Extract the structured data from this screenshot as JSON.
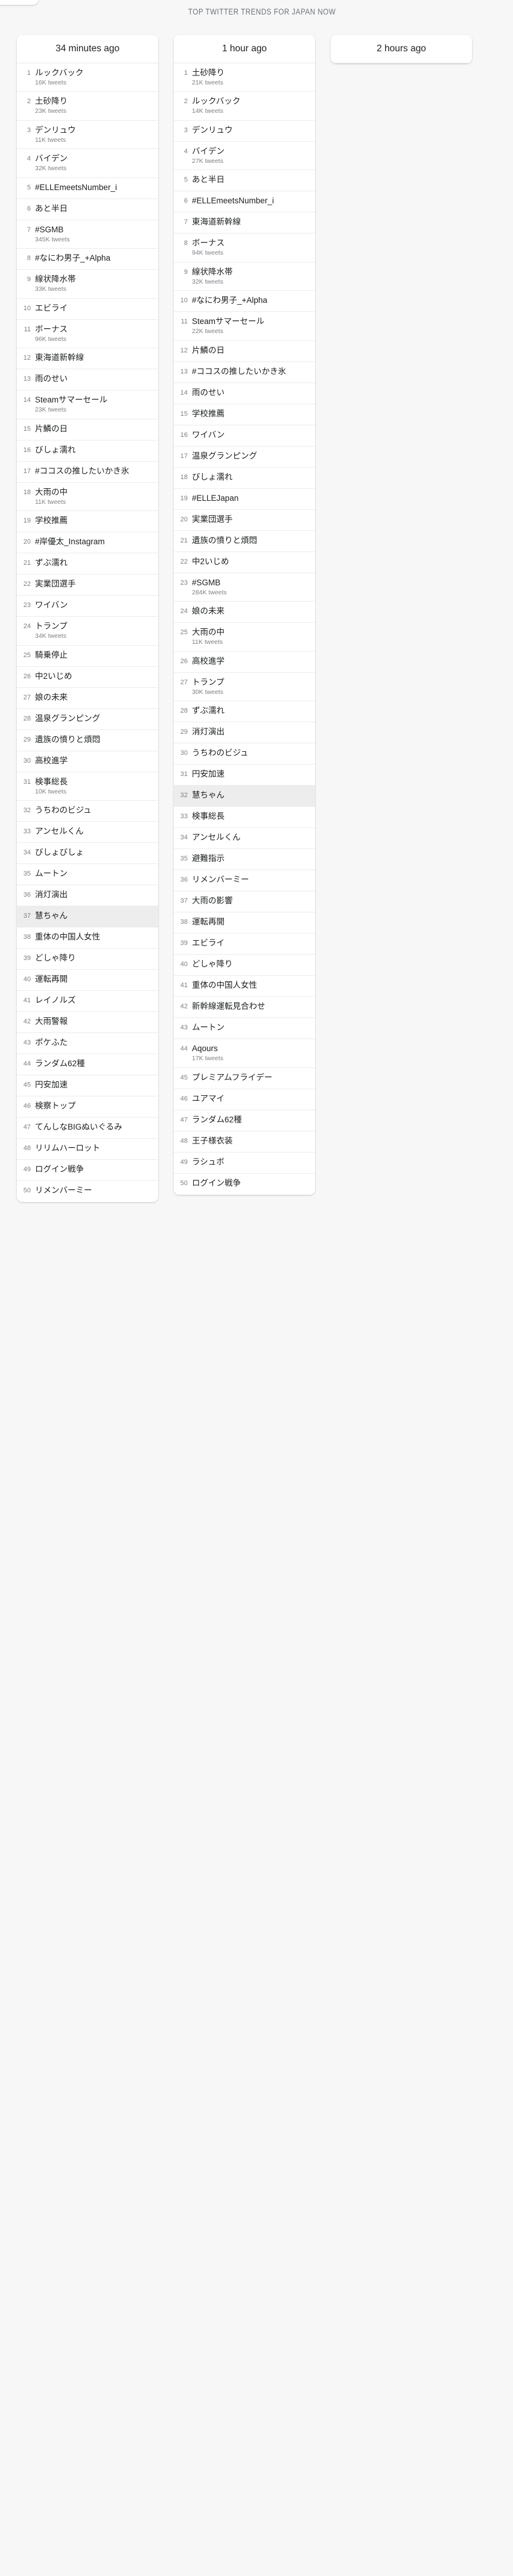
{
  "page": {
    "header_title": "TOP TWITTER TRENDS FOR JAPAN NOW",
    "background_color": "#f7f7f8",
    "card_color": "#ffffff",
    "highlight_color": "#ededed",
    "text_color": "#1b1d1f",
    "muted_color": "#7d8085"
  },
  "columns": [
    {
      "timestamp_label": "34 minutes ago",
      "items": [
        {
          "rank": "1",
          "name": "ルックバック",
          "count": "16K tweets",
          "highlight": false
        },
        {
          "rank": "2",
          "name": "土砂降り",
          "count": "23K tweets",
          "highlight": false
        },
        {
          "rank": "3",
          "name": "デンリュウ",
          "count": "11K tweets",
          "highlight": false
        },
        {
          "rank": "4",
          "name": "バイデン",
          "count": "32K tweets",
          "highlight": false
        },
        {
          "rank": "5",
          "name": "#ELLEmeetsNumber_i",
          "count": "",
          "highlight": false
        },
        {
          "rank": "6",
          "name": "あと半日",
          "count": "",
          "highlight": false
        },
        {
          "rank": "7",
          "name": "#SGMB",
          "count": "345K tweets",
          "highlight": false
        },
        {
          "rank": "8",
          "name": "#なにわ男子_+Alpha",
          "count": "",
          "highlight": false
        },
        {
          "rank": "9",
          "name": "線状降水帯",
          "count": "33K tweets",
          "highlight": false
        },
        {
          "rank": "10",
          "name": "エビライ",
          "count": "",
          "highlight": false
        },
        {
          "rank": "11",
          "name": "ボーナス",
          "count": "96K tweets",
          "highlight": false
        },
        {
          "rank": "12",
          "name": "東海道新幹線",
          "count": "",
          "highlight": false
        },
        {
          "rank": "13",
          "name": "雨のせい",
          "count": "",
          "highlight": false
        },
        {
          "rank": "14",
          "name": "Steamサマーセール",
          "count": "23K tweets",
          "highlight": false
        },
        {
          "rank": "15",
          "name": "片鱗の日",
          "count": "",
          "highlight": false
        },
        {
          "rank": "16",
          "name": "びしょ濡れ",
          "count": "",
          "highlight": false
        },
        {
          "rank": "17",
          "name": "#ココスの推したいかき氷",
          "count": "",
          "highlight": false
        },
        {
          "rank": "18",
          "name": "大雨の中",
          "count": "11K tweets",
          "highlight": false
        },
        {
          "rank": "19",
          "name": "学校推薦",
          "count": "",
          "highlight": false
        },
        {
          "rank": "20",
          "name": "#岸優太_Instagram",
          "count": "",
          "highlight": false
        },
        {
          "rank": "21",
          "name": "ずぶ濡れ",
          "count": "",
          "highlight": false
        },
        {
          "rank": "22",
          "name": "実業団選手",
          "count": "",
          "highlight": false
        },
        {
          "rank": "23",
          "name": "ワイバン",
          "count": "",
          "highlight": false
        },
        {
          "rank": "24",
          "name": "トランプ",
          "count": "34K tweets",
          "highlight": false
        },
        {
          "rank": "25",
          "name": "騎乗停止",
          "count": "",
          "highlight": false
        },
        {
          "rank": "26",
          "name": "中2いじめ",
          "count": "",
          "highlight": false
        },
        {
          "rank": "27",
          "name": "娘の未来",
          "count": "",
          "highlight": false
        },
        {
          "rank": "28",
          "name": "温泉グランピング",
          "count": "",
          "highlight": false
        },
        {
          "rank": "29",
          "name": "遺族の憤りと煩悶",
          "count": "",
          "highlight": false
        },
        {
          "rank": "30",
          "name": "高校進学",
          "count": "",
          "highlight": false
        },
        {
          "rank": "31",
          "name": "検事総長",
          "count": "10K tweets",
          "highlight": false
        },
        {
          "rank": "32",
          "name": "うちわのビジュ",
          "count": "",
          "highlight": false
        },
        {
          "rank": "33",
          "name": "アンセルくん",
          "count": "",
          "highlight": false
        },
        {
          "rank": "34",
          "name": "びしょびしょ",
          "count": "",
          "highlight": false
        },
        {
          "rank": "35",
          "name": "ムートン",
          "count": "",
          "highlight": false
        },
        {
          "rank": "36",
          "name": "消灯演出",
          "count": "",
          "highlight": false
        },
        {
          "rank": "37",
          "name": "慧ちゃん",
          "count": "",
          "highlight": true
        },
        {
          "rank": "38",
          "name": "重体の中国人女性",
          "count": "",
          "highlight": false
        },
        {
          "rank": "39",
          "name": "どしゃ降り",
          "count": "",
          "highlight": false
        },
        {
          "rank": "40",
          "name": "運転再開",
          "count": "",
          "highlight": false
        },
        {
          "rank": "41",
          "name": "レイノルズ",
          "count": "",
          "highlight": false
        },
        {
          "rank": "42",
          "name": "大雨警報",
          "count": "",
          "highlight": false
        },
        {
          "rank": "43",
          "name": "ポケふた",
          "count": "",
          "highlight": false
        },
        {
          "rank": "44",
          "name": "ランダム62種",
          "count": "",
          "highlight": false
        },
        {
          "rank": "45",
          "name": "円安加速",
          "count": "",
          "highlight": false
        },
        {
          "rank": "46",
          "name": "検察トップ",
          "count": "",
          "highlight": false
        },
        {
          "rank": "47",
          "name": "てんしなBIGぬいぐるみ",
          "count": "",
          "highlight": false
        },
        {
          "rank": "48",
          "name": "リリムハーロット",
          "count": "",
          "highlight": false
        },
        {
          "rank": "49",
          "name": "ログイン戦争",
          "count": "",
          "highlight": false
        },
        {
          "rank": "50",
          "name": "リメンバーミー",
          "count": "",
          "highlight": false
        }
      ]
    },
    {
      "timestamp_label": "1 hour ago",
      "items": [
        {
          "rank": "1",
          "name": "土砂降り",
          "count": "21K tweets",
          "highlight": false
        },
        {
          "rank": "2",
          "name": "ルックバック",
          "count": "14K tweets",
          "highlight": false
        },
        {
          "rank": "3",
          "name": "デンリュウ",
          "count": "",
          "highlight": false
        },
        {
          "rank": "4",
          "name": "バイデン",
          "count": "27K tweets",
          "highlight": false
        },
        {
          "rank": "5",
          "name": "あと半日",
          "count": "",
          "highlight": false
        },
        {
          "rank": "6",
          "name": "#ELLEmeetsNumber_i",
          "count": "",
          "highlight": false
        },
        {
          "rank": "7",
          "name": "東海道新幹線",
          "count": "",
          "highlight": false
        },
        {
          "rank": "8",
          "name": "ボーナス",
          "count": "94K tweets",
          "highlight": false
        },
        {
          "rank": "9",
          "name": "線状降水帯",
          "count": "32K tweets",
          "highlight": false
        },
        {
          "rank": "10",
          "name": "#なにわ男子_+Alpha",
          "count": "",
          "highlight": false
        },
        {
          "rank": "11",
          "name": "Steamサマーセール",
          "count": "22K tweets",
          "highlight": false
        },
        {
          "rank": "12",
          "name": "片鱗の日",
          "count": "",
          "highlight": false
        },
        {
          "rank": "13",
          "name": "#ココスの推したいかき氷",
          "count": "",
          "highlight": false
        },
        {
          "rank": "14",
          "name": "雨のせい",
          "count": "",
          "highlight": false
        },
        {
          "rank": "15",
          "name": "学校推薦",
          "count": "",
          "highlight": false
        },
        {
          "rank": "16",
          "name": "ワイバン",
          "count": "",
          "highlight": false
        },
        {
          "rank": "17",
          "name": "温泉グランピング",
          "count": "",
          "highlight": false
        },
        {
          "rank": "18",
          "name": "びしょ濡れ",
          "count": "",
          "highlight": false
        },
        {
          "rank": "19",
          "name": "#ELLEJapan",
          "count": "",
          "highlight": false
        },
        {
          "rank": "20",
          "name": "実業団選手",
          "count": "",
          "highlight": false
        },
        {
          "rank": "21",
          "name": "遺族の憤りと煩悶",
          "count": "",
          "highlight": false
        },
        {
          "rank": "22",
          "name": "中2いじめ",
          "count": "",
          "highlight": false
        },
        {
          "rank": "23",
          "name": "#SGMB",
          "count": "284K tweets",
          "highlight": false
        },
        {
          "rank": "24",
          "name": "娘の未来",
          "count": "",
          "highlight": false
        },
        {
          "rank": "25",
          "name": "大雨の中",
          "count": "11K tweets",
          "highlight": false
        },
        {
          "rank": "26",
          "name": "高校進学",
          "count": "",
          "highlight": false
        },
        {
          "rank": "27",
          "name": "トランプ",
          "count": "30K tweets",
          "highlight": false
        },
        {
          "rank": "28",
          "name": "ずぶ濡れ",
          "count": "",
          "highlight": false
        },
        {
          "rank": "29",
          "name": "消灯演出",
          "count": "",
          "highlight": false
        },
        {
          "rank": "30",
          "name": "うちわのビジュ",
          "count": "",
          "highlight": false
        },
        {
          "rank": "31",
          "name": "円安加速",
          "count": "",
          "highlight": false
        },
        {
          "rank": "32",
          "name": "慧ちゃん",
          "count": "",
          "highlight": true
        },
        {
          "rank": "33",
          "name": "検事総長",
          "count": "",
          "highlight": false
        },
        {
          "rank": "34",
          "name": "アンセルくん",
          "count": "",
          "highlight": false
        },
        {
          "rank": "35",
          "name": "避難指示",
          "count": "",
          "highlight": false
        },
        {
          "rank": "36",
          "name": "リメンバーミー",
          "count": "",
          "highlight": false
        },
        {
          "rank": "37",
          "name": "大雨の影響",
          "count": "",
          "highlight": false
        },
        {
          "rank": "38",
          "name": "運転再開",
          "count": "",
          "highlight": false
        },
        {
          "rank": "39",
          "name": "エビライ",
          "count": "",
          "highlight": false
        },
        {
          "rank": "40",
          "name": "どしゃ降り",
          "count": "",
          "highlight": false
        },
        {
          "rank": "41",
          "name": "重体の中国人女性",
          "count": "",
          "highlight": false
        },
        {
          "rank": "42",
          "name": "新幹線運転見合わせ",
          "count": "",
          "highlight": false
        },
        {
          "rank": "43",
          "name": "ムートン",
          "count": "",
          "highlight": false
        },
        {
          "rank": "44",
          "name": "Aqours",
          "count": "17K tweets",
          "highlight": false
        },
        {
          "rank": "45",
          "name": "プレミアムフライデー",
          "count": "",
          "highlight": false
        },
        {
          "rank": "46",
          "name": "ユアマイ",
          "count": "",
          "highlight": false
        },
        {
          "rank": "47",
          "name": "ランダム62種",
          "count": "",
          "highlight": false
        },
        {
          "rank": "48",
          "name": "王子様衣装",
          "count": "",
          "highlight": false
        },
        {
          "rank": "49",
          "name": "ラシュボ",
          "count": "",
          "highlight": false
        },
        {
          "rank": "50",
          "name": "ログイン戦争",
          "count": "",
          "highlight": false
        }
      ]
    },
    {
      "timestamp_label": "2 hours ago",
      "items": []
    }
  ]
}
